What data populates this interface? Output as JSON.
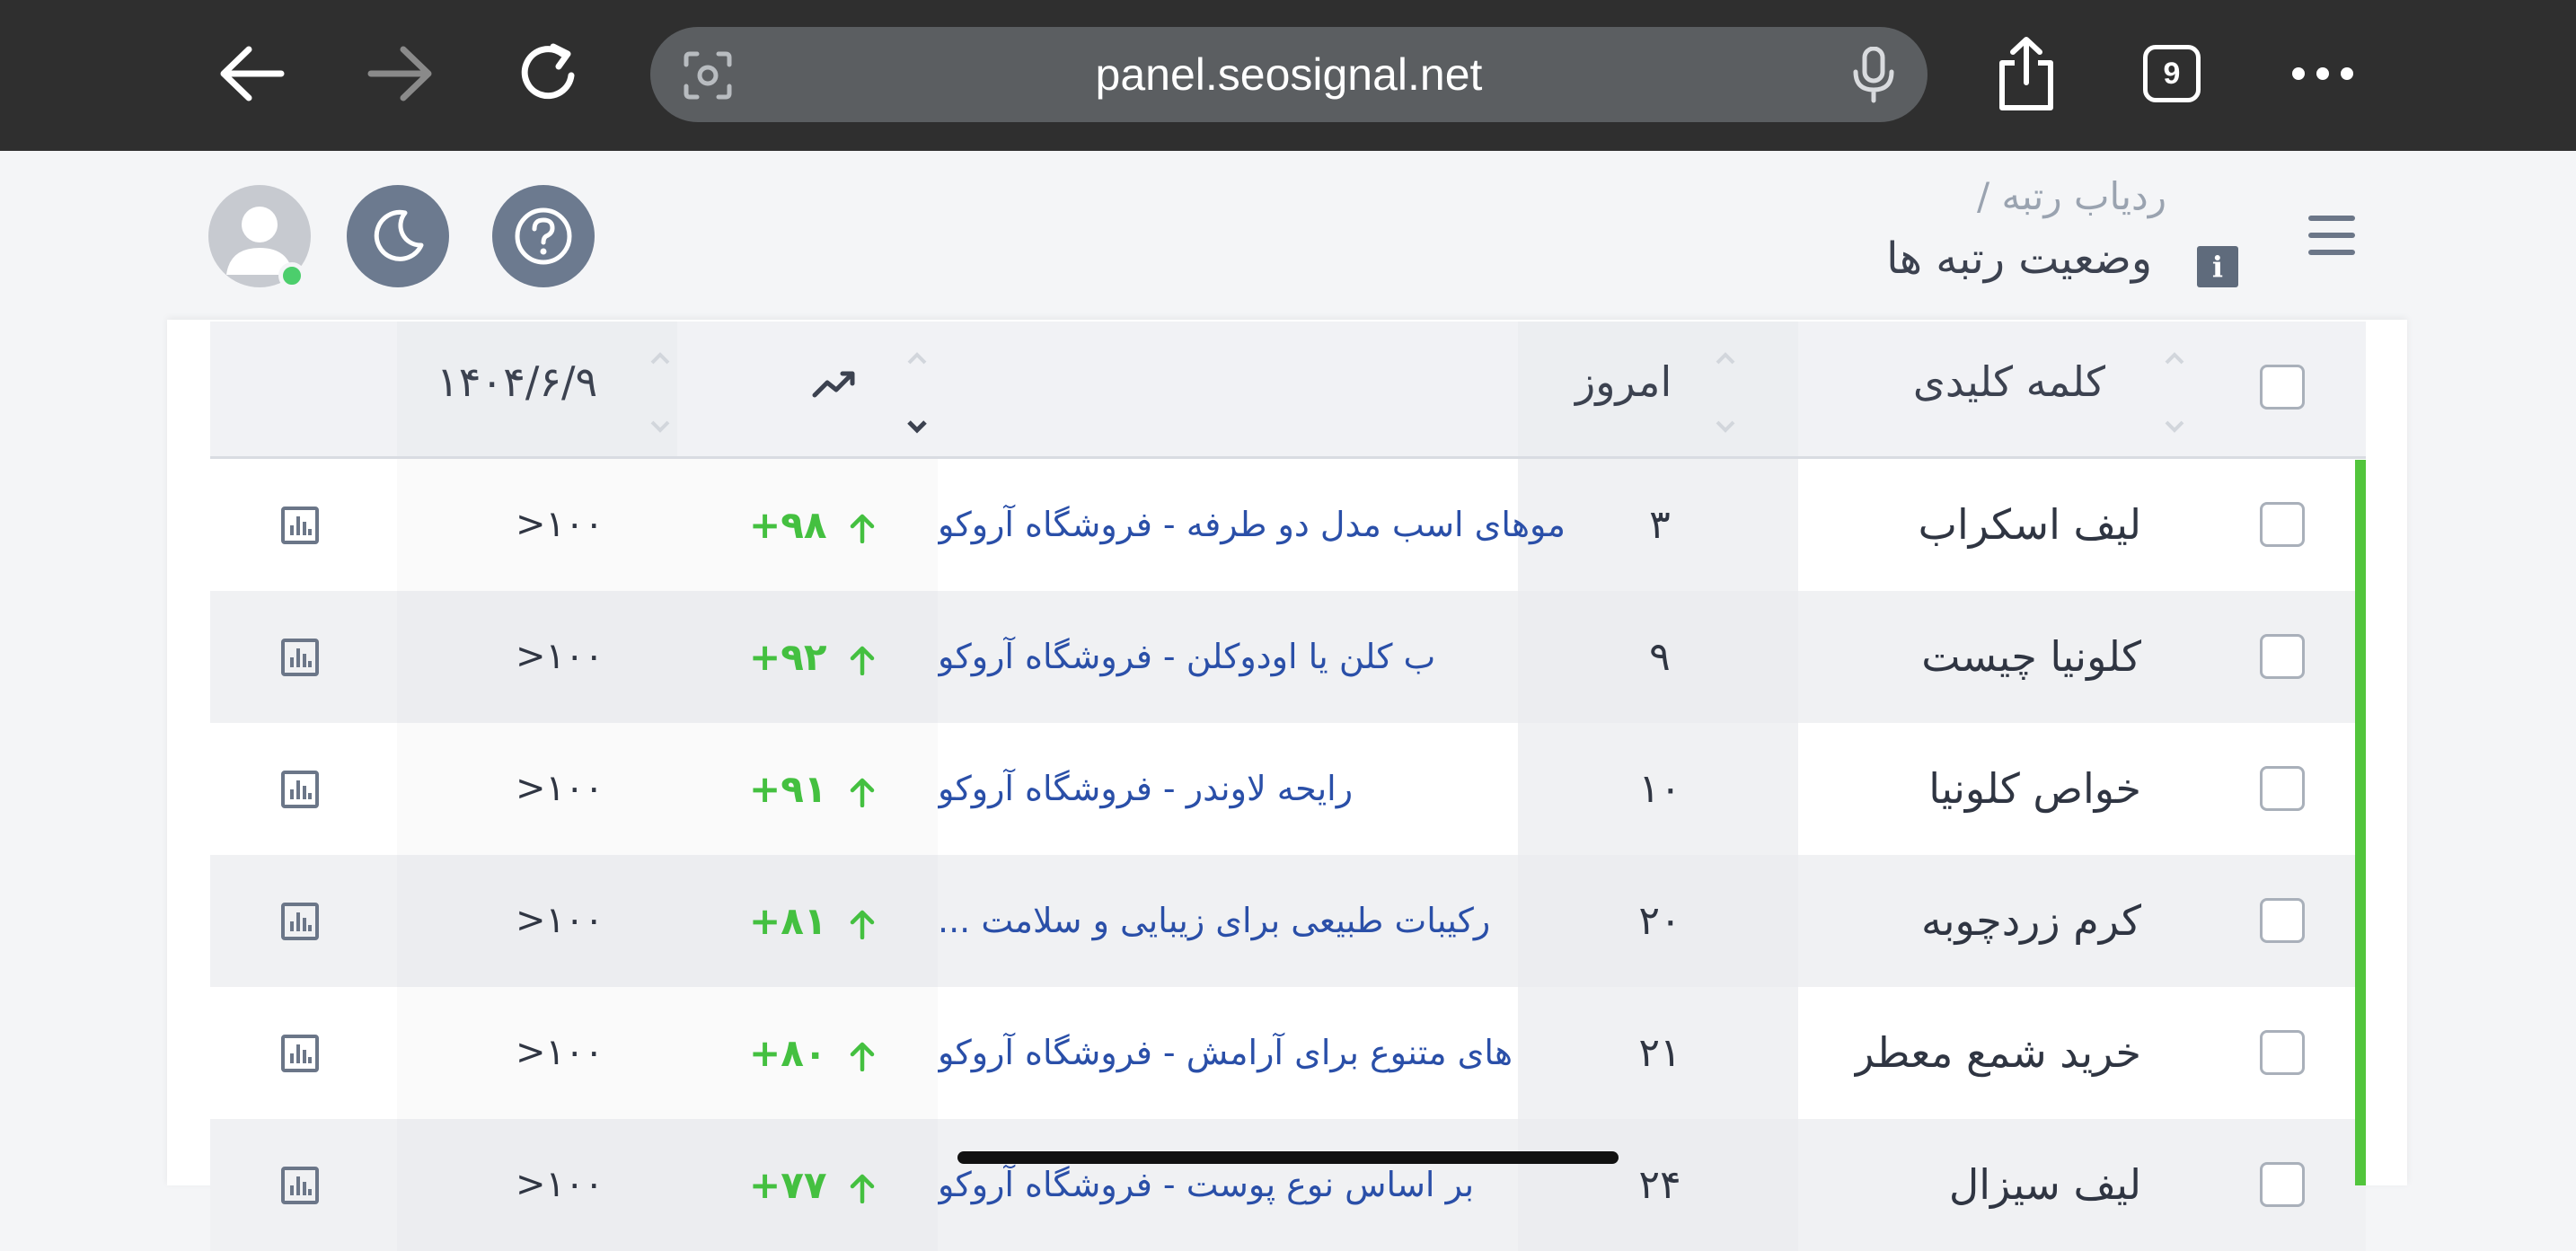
{
  "browser": {
    "url": "panel.seosignal.net",
    "tab_count": "9"
  },
  "header": {
    "breadcrumb": "ردیاب رتبه /",
    "title": "وضعیت رتبه ها",
    "info_label": "i"
  },
  "table": {
    "columns": {
      "keyword": "کلمه کلیدی",
      "today": "امروز",
      "date": "۱۴۰۴/۶/۹"
    },
    "rows": [
      {
        "keyword": "لیف اسکراب",
        "position": "۳",
        "url_title": "موهای اسب مدل دو طرفه - فروشگاه آروکو",
        "change": "+۹۸",
        "date_value": ">۱۰۰"
      },
      {
        "keyword": "کلونیا چیست",
        "position": "۹",
        "url_title": "ب کلن یا اودوکلن - فروشگاه آروکو",
        "change": "+۹۲",
        "date_value": ">۱۰۰"
      },
      {
        "keyword": "خواص کلونیا",
        "position": "۱۰",
        "url_title": "رایحه لاوندر - فروشگاه آروکو",
        "change": "+۹۱",
        "date_value": ">۱۰۰"
      },
      {
        "keyword": "کرم زردچوبه",
        "position": "۲۰",
        "url_title": "رکیبات طبیعی برای زیبایی و سلامت ...",
        "change": "+۸۱",
        "date_value": ">۱۰۰"
      },
      {
        "keyword": "خرید شمع معطر",
        "position": "۲۱",
        "url_title": "های متنوع برای آرامش - فروشگاه آروکو",
        "change": "+۸۰",
        "date_value": ">۱۰۰"
      },
      {
        "keyword": "لیف سیزال",
        "position": "۲۴",
        "url_title": "بر اساس نوع پوست - فروشگاه آروکو",
        "change": "+۷۷",
        "date_value": ">۱۰۰"
      }
    ]
  },
  "colors": {
    "accent_green": "#44c040",
    "link_blue": "#2a4fa8",
    "status_bar": "#52c53c"
  }
}
